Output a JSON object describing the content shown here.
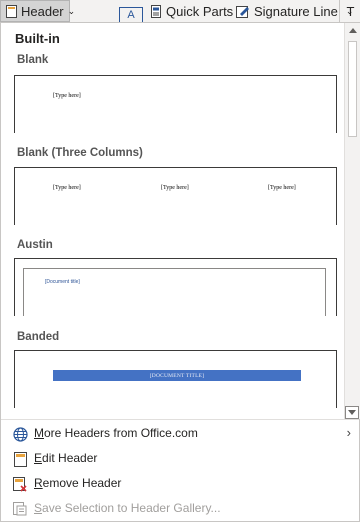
{
  "ribbon": {
    "header_label": "Header",
    "textbox_label": "A",
    "quick_parts_label": "Quick Parts",
    "signature_line_label": "Signature Line",
    "overflow_label": "T"
  },
  "gallery": {
    "category": "Built-in",
    "sections": [
      {
        "title": "Blank",
        "placeholders": [
          "[Type here]"
        ]
      },
      {
        "title": "Blank (Three Columns)",
        "placeholders": [
          "[Type here]",
          "[Type here]",
          "[Type here]"
        ]
      },
      {
        "title": "Austin",
        "placeholders": [
          "[Document title]"
        ]
      },
      {
        "title": "Banded",
        "placeholders": [
          "[DOCUMENT TITLE]"
        ]
      }
    ]
  },
  "menu": {
    "items": [
      {
        "accel": "M",
        "rest": "ore Headers from Office.com",
        "icon": "globe-icon",
        "enabled": true,
        "has_submenu": true
      },
      {
        "accel": "E",
        "rest": "dit Header",
        "icon": "edit-header-icon",
        "enabled": true,
        "has_submenu": false
      },
      {
        "accel": "R",
        "rest": "emove Header",
        "icon": "remove-header-icon",
        "enabled": true,
        "has_submenu": false
      },
      {
        "accel": "S",
        "rest": "ave Selection to Header Gallery...",
        "icon": "save-to-gallery-icon",
        "enabled": false,
        "has_submenu": false
      }
    ]
  },
  "colors": {
    "accent_blue": "#4472c4",
    "austin_title_blue": "#2f5597",
    "remove_red": "#d13438",
    "disabled_text": "#a19f9d"
  }
}
